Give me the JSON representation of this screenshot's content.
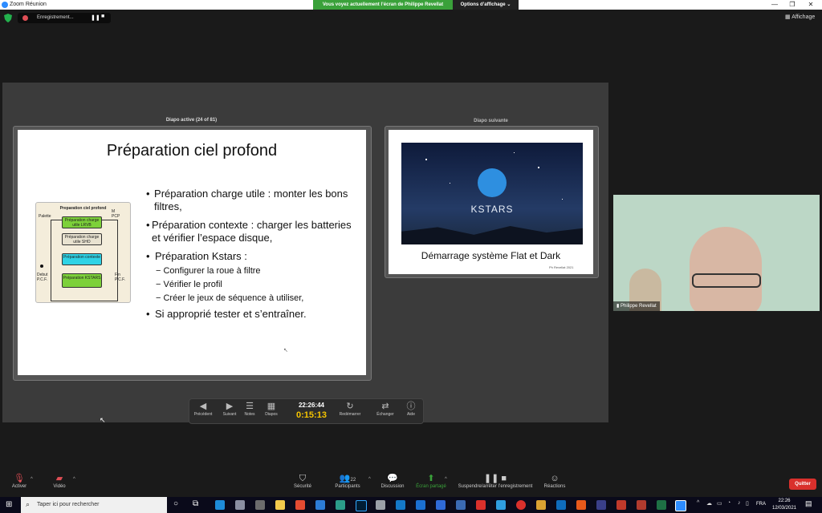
{
  "window": {
    "title": "Zoom Réunion",
    "share_banner": "Vous voyez actuellement l’écran de Philippe Revellat",
    "view_options": "Options d’affichage",
    "recording_label": "Enregistrement...",
    "view_button": "Affichage"
  },
  "presenter": {
    "current_label": "Diapo active (24 of 81)",
    "next_label": "Diapo suivante",
    "clock": "22:26:44",
    "timer": "0:15:13",
    "buttons": [
      "Précédent",
      "Suivant",
      "Notes",
      "Diapos",
      "Redémarrer",
      "Échanger",
      "Aide"
    ]
  },
  "current_slide": {
    "title": "Préparation ciel profond",
    "bullets": [
      "Préparation charge utile : monter les bons filtres,",
      "Préparation contexte : charger les batteries et vérifier l’espace disque,",
      "Préparation Kstars :"
    ],
    "sub_bullets": [
      "Configurer la roue à filtre",
      "Vérifier le profil",
      "Créer le jeux de séquence à utiliser,"
    ],
    "last_bullet": "Si approprié tester et s’entraîner.",
    "diagram": {
      "title": "Preparation ciel profond",
      "palette": "Palette",
      "m_pcp": "M\nPCP",
      "box1": "Préparation charge utile LRVB",
      "box2": "Préparation charge utile SHO",
      "box3": "Préparation contexte",
      "box4": "Préparation KSTARS",
      "debut": "Debut\nP.C.F.",
      "fin": "Fin\nP.C.F."
    }
  },
  "next_slide": {
    "image_text": "KSTARS",
    "title": "Démarrage système Flat et Dark",
    "footer": "Ph Revellat 2021"
  },
  "webcam": {
    "name": "Philippe Revellat"
  },
  "zoom_controls": {
    "activer": "Activer",
    "video": "Vidéo",
    "securite": "Sécurité",
    "participants": "Participants",
    "participants_count": "22",
    "discussion": "Discussion",
    "ecran_partage": "Écran partagé",
    "suspendre": "Suspendre/arrêter l’enregistrement",
    "reactions": "Réactions",
    "quitter": "Quitter"
  },
  "taskbar": {
    "search_placeholder": "Taper ici pour rechercher",
    "language": "FRA",
    "time": "22:26",
    "date": "12/03/2021"
  },
  "colors": {
    "zoom_green": "#3aa13a",
    "quit_red": "#d9302c",
    "timer_yellow": "#f5c400",
    "diagram_green": "#7dd13a",
    "diagram_cyan": "#2fd3e6"
  }
}
